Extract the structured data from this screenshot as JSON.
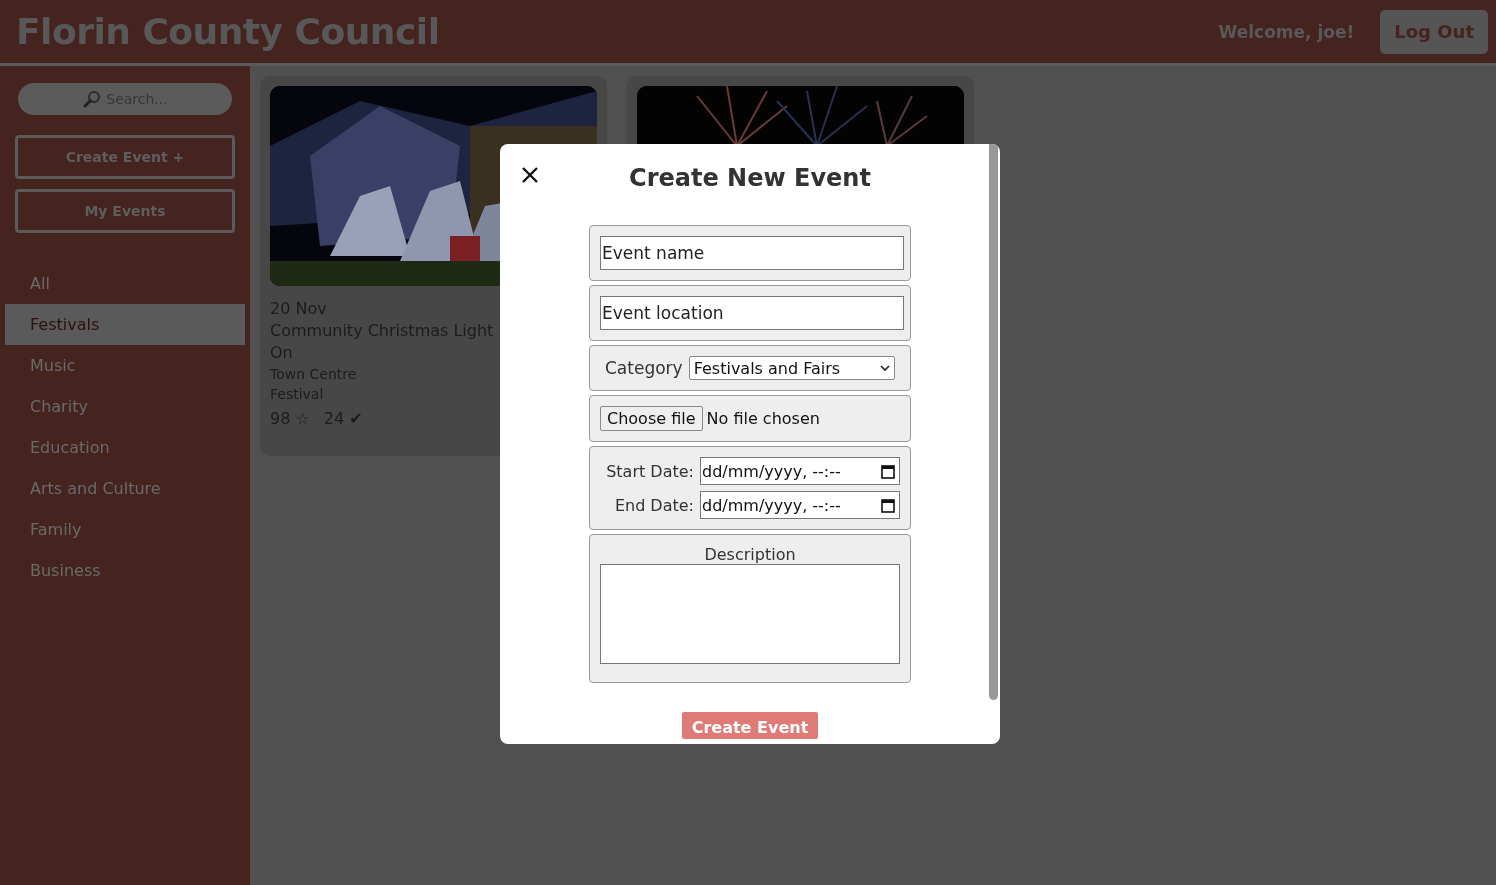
{
  "header": {
    "title": "Florin County Council",
    "welcome": "Welcome, joe!",
    "logout": "Log Out"
  },
  "sidebar": {
    "search": {
      "placeholder": "Search..."
    },
    "buttons": [
      "Create Event +",
      "My Events"
    ],
    "categories": [
      {
        "label": "All",
        "selected": false
      },
      {
        "label": "Festivals",
        "selected": true
      },
      {
        "label": "Music",
        "selected": false
      },
      {
        "label": "Charity",
        "selected": false
      },
      {
        "label": "Education",
        "selected": false
      },
      {
        "label": "Arts and Culture",
        "selected": false
      },
      {
        "label": "Family",
        "selected": false
      },
      {
        "label": "Business",
        "selected": false
      }
    ]
  },
  "events": [
    {
      "picture": {
        "kind": "picture"
      },
      "date": "20 Nov",
      "title_lines": [
        "Community Christmas Light",
        "On"
      ],
      "location": "Town Centre",
      "category": "Festival",
      "rating": "98 ☆",
      "attending": "24 ✔"
    },
    {
      "picture": {
        "kind": "picture"
      }
    }
  ],
  "modal": {
    "title": "Create New Event",
    "fields": [
      {
        "kind": "text",
        "placeholder": "Event name"
      },
      {
        "kind": "text",
        "placeholder": "Event location"
      },
      {
        "kind": "select",
        "label": "Category",
        "value": "Festivals and Fairs"
      },
      {
        "kind": "file",
        "button": "Choose file",
        "status": "No file chosen"
      },
      {
        "kind": "dates",
        "rows": [
          {
            "label": "Start Date:",
            "value": "dd/mm/yyyy, --:--"
          },
          {
            "label": "End Date:",
            "value": "dd/mm/yyyy, --:--"
          }
        ]
      },
      {
        "kind": "textarea",
        "label": "Description"
      }
    ],
    "submit": "Create Event"
  }
}
